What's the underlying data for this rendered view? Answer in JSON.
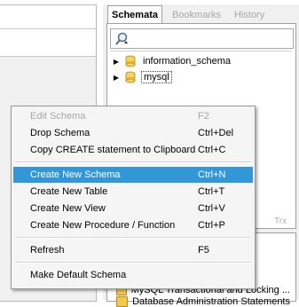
{
  "tabs": [
    "Schemata",
    "Bookmarks",
    "History"
  ],
  "tree": [
    {
      "label": "information_schema",
      "icon": "database-icon"
    },
    {
      "label": "mysql",
      "icon": "database-icon",
      "selected": true
    }
  ],
  "lower_panel": {
    "tab_fragment": "Trx",
    "items": [
      "MySQL Transactional and Locking ...",
      "Database Administration Statements"
    ]
  },
  "context_menu": [
    {
      "label": "Edit Schema",
      "shortcut": "F2",
      "disabled": true
    },
    {
      "label": "Drop Schema",
      "shortcut": "Ctrl+Del"
    },
    {
      "label": "Copy CREATE statement to Clipboard",
      "shortcut": "Ctrl+C"
    },
    {
      "label": "Create New Schema",
      "shortcut": "Ctrl+N",
      "highlighted": true
    },
    {
      "label": "Create New Table",
      "shortcut": "Ctrl+T"
    },
    {
      "label": "Create New View",
      "shortcut": "Ctrl+V"
    },
    {
      "label": "Create New Procedure / Function",
      "shortcut": "Ctrl+P"
    },
    {
      "label": "Refresh",
      "shortcut": "F5"
    },
    {
      "label": "Make Default Schema",
      "shortcut": ""
    }
  ],
  "colors": {
    "highlight": "#3296d7",
    "menu_bg": "#f5f5f5"
  }
}
